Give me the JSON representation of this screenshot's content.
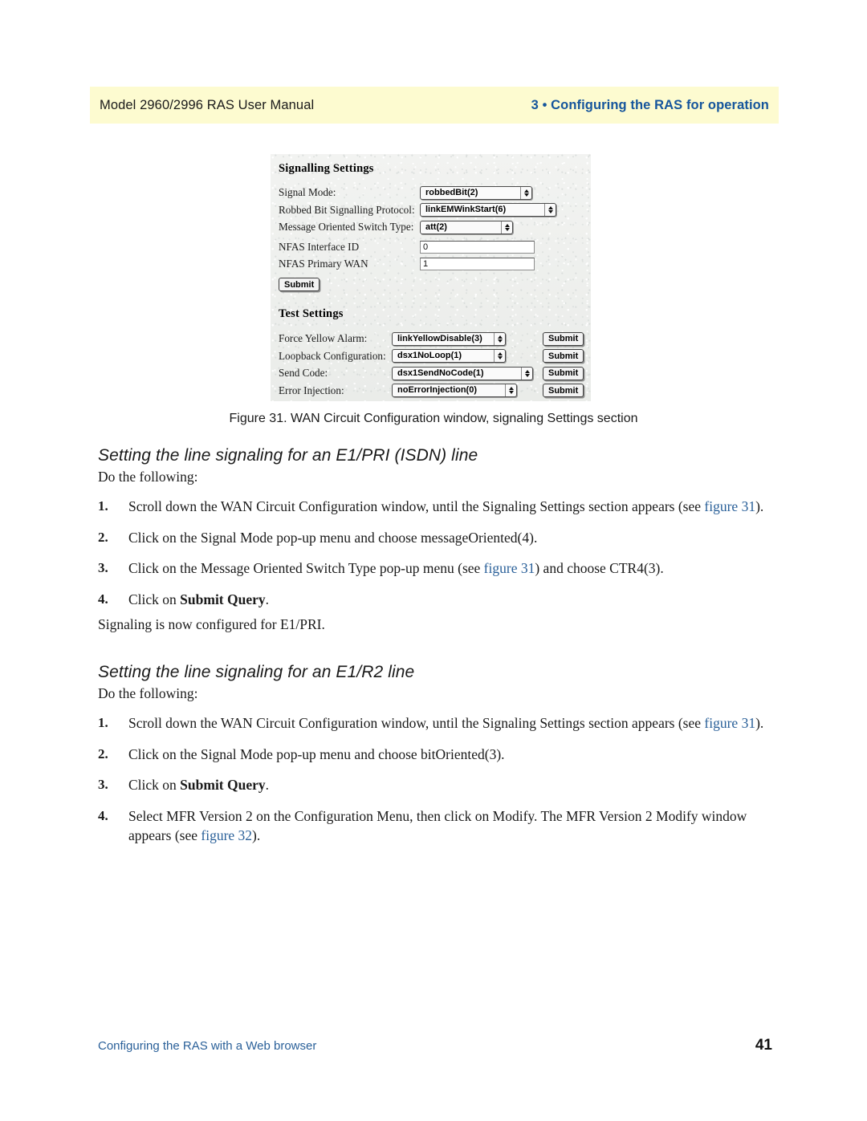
{
  "header": {
    "left_text": "Model 2960/2996 RAS User Manual",
    "right_text": "3 • Configuring the RAS for operation",
    "banner_color": "#fdfbd0",
    "accent_color": "#15559c"
  },
  "figure": {
    "caption": "Figure 31. WAN Circuit Configuration window, signaling Settings section",
    "signalling": {
      "title": "Signalling Settings",
      "rows": [
        {
          "label": "Signal Mode:",
          "control": "select",
          "value": "robbedBit(2)"
        },
        {
          "label": "Robbed Bit Signalling Protocol:",
          "control": "select",
          "value": "linkEMWinkStart(6)"
        },
        {
          "label": "Message Oriented Switch Type:",
          "control": "select",
          "value": "att(2)"
        },
        {
          "label": "NFAS Interface ID",
          "control": "text",
          "value": "0"
        },
        {
          "label": "NFAS Primary WAN",
          "control": "text",
          "value": "1"
        }
      ],
      "submit_label": "Submit"
    },
    "test": {
      "title": "Test Settings",
      "rows": [
        {
          "label": "Force Yellow Alarm:",
          "value": "linkYellowDisable(3)",
          "submit_label": "Submit"
        },
        {
          "label": "Loopback Configuration:",
          "value": "dsx1NoLoop(1)",
          "submit_label": "Submit"
        },
        {
          "label": "Send Code:",
          "value": "dsx1SendNoCode(1)",
          "submit_label": "Submit"
        },
        {
          "label": "Error Injection:",
          "value": "noErrorInjection(0)",
          "submit_label": "Submit"
        }
      ]
    }
  },
  "sections": [
    {
      "heading": "Setting the line signaling for an E1/PRI (ISDN) line",
      "lead": "Do the following:",
      "steps": [
        {
          "num": "1.",
          "parts": [
            {
              "t": "Scroll down the WAN Circuit Configuration window, until the Signaling Settings section appears (see "
            },
            {
              "t": "figure 31",
              "style": "link"
            },
            {
              "t": ")."
            }
          ]
        },
        {
          "num": "2.",
          "parts": [
            {
              "t": "Click on the Signal Mode pop-up menu and choose messageOriented(4)."
            }
          ]
        },
        {
          "num": "3.",
          "parts": [
            {
              "t": "Click on the Message Oriented Switch Type pop-up menu (see "
            },
            {
              "t": "figure 31",
              "style": "link"
            },
            {
              "t": ") and choose CTR4(3)."
            }
          ]
        },
        {
          "num": "4.",
          "parts": [
            {
              "t": "Click on "
            },
            {
              "t": "Submit Query",
              "style": "bold"
            },
            {
              "t": "."
            }
          ]
        }
      ],
      "closing": "Signaling is now configured for E1/PRI."
    },
    {
      "heading": "Setting the line signaling for an E1/R2 line",
      "lead": "Do the following:",
      "steps": [
        {
          "num": "1.",
          "parts": [
            {
              "t": "Scroll down the WAN Circuit Configuration window, until the Signaling Settings section appears (see "
            },
            {
              "t": "figure 31",
              "style": "link"
            },
            {
              "t": ")."
            }
          ]
        },
        {
          "num": "2.",
          "parts": [
            {
              "t": "Click on the Signal Mode pop-up menu and choose bitOriented(3)."
            }
          ]
        },
        {
          "num": "3.",
          "parts": [
            {
              "t": "Click on "
            },
            {
              "t": "Submit Query",
              "style": "bold"
            },
            {
              "t": "."
            }
          ]
        },
        {
          "num": "4.",
          "parts": [
            {
              "t": "Select MFR Version 2 on the Configuration Menu, then click on Modify. The MFR Version 2 Modify window appears (see "
            },
            {
              "t": "figure 32",
              "style": "link"
            },
            {
              "t": ")."
            }
          ]
        }
      ],
      "closing": ""
    }
  ],
  "footer": {
    "left_text": "Configuring the RAS with a Web browser",
    "page_number": "41",
    "link_color": "#2a6099"
  }
}
